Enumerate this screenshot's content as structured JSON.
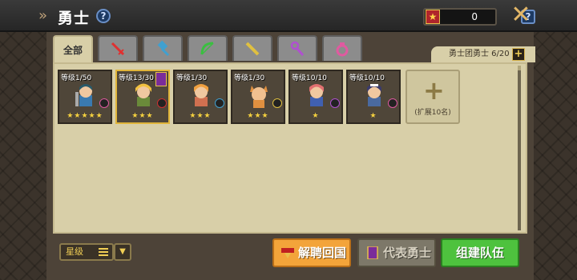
{
  "header": {
    "title": "勇士",
    "currency_amount": "0"
  },
  "tabs": [
    {
      "label": "全部",
      "icon": "all",
      "active": true
    },
    {
      "label": "",
      "icon": "sword-icon"
    },
    {
      "label": "",
      "icon": "hammer-icon"
    },
    {
      "label": "",
      "icon": "bow-icon"
    },
    {
      "label": "",
      "icon": "gun-icon"
    },
    {
      "label": "",
      "icon": "staff-icon"
    },
    {
      "label": "",
      "icon": "ring-icon"
    }
  ],
  "guild": {
    "label": "勇士团勇士 6/20",
    "plus": "+"
  },
  "heroes": [
    {
      "level": "等级1/50",
      "stars": "★★★★★",
      "class_color": "#e05aa0",
      "hair": "#2a5a6a",
      "skin": "#f0c8a0",
      "outfit": "#3a7ab0"
    },
    {
      "level": "等级13/30",
      "stars": "★★★",
      "class_color": "#d03030",
      "hair": "#f0c040",
      "skin": "#f0c8a0",
      "outfit": "#6a8a3a",
      "representative": true
    },
    {
      "level": "等级1/30",
      "stars": "★★★",
      "class_color": "#40a0d0",
      "hair": "#f0a040",
      "skin": "#f0c8a0",
      "outfit": "#d07050"
    },
    {
      "level": "等级1/30",
      "stars": "★★★",
      "class_color": "#e0c040",
      "hair": "#e09040",
      "skin": "#f0c090",
      "outfit": "#e09040"
    },
    {
      "level": "等级10/10",
      "stars": "★",
      "class_color": "#b050d0",
      "hair": "#e07070",
      "skin": "#f0c8a0",
      "outfit": "#4060b0"
    },
    {
      "level": "等级10/10",
      "stars": "★",
      "class_color": "#e05aa0",
      "hair": "#3a3a6a",
      "skin": "#f0c8a0",
      "outfit": "#4a6aa0"
    }
  ],
  "expand": {
    "plus": "+",
    "label": "(扩展10名)"
  },
  "sort": {
    "label": "星级",
    "toggle": "▼"
  },
  "buttons": {
    "dismiss": "解聘回国",
    "represent": "代表勇士",
    "form_team": "组建队伍"
  },
  "colors": {
    "dismiss": "#f3a43a",
    "represent_disabled": "#7d7869",
    "form_team": "#4ec23e",
    "panel_bg": "#d8cfa8"
  }
}
